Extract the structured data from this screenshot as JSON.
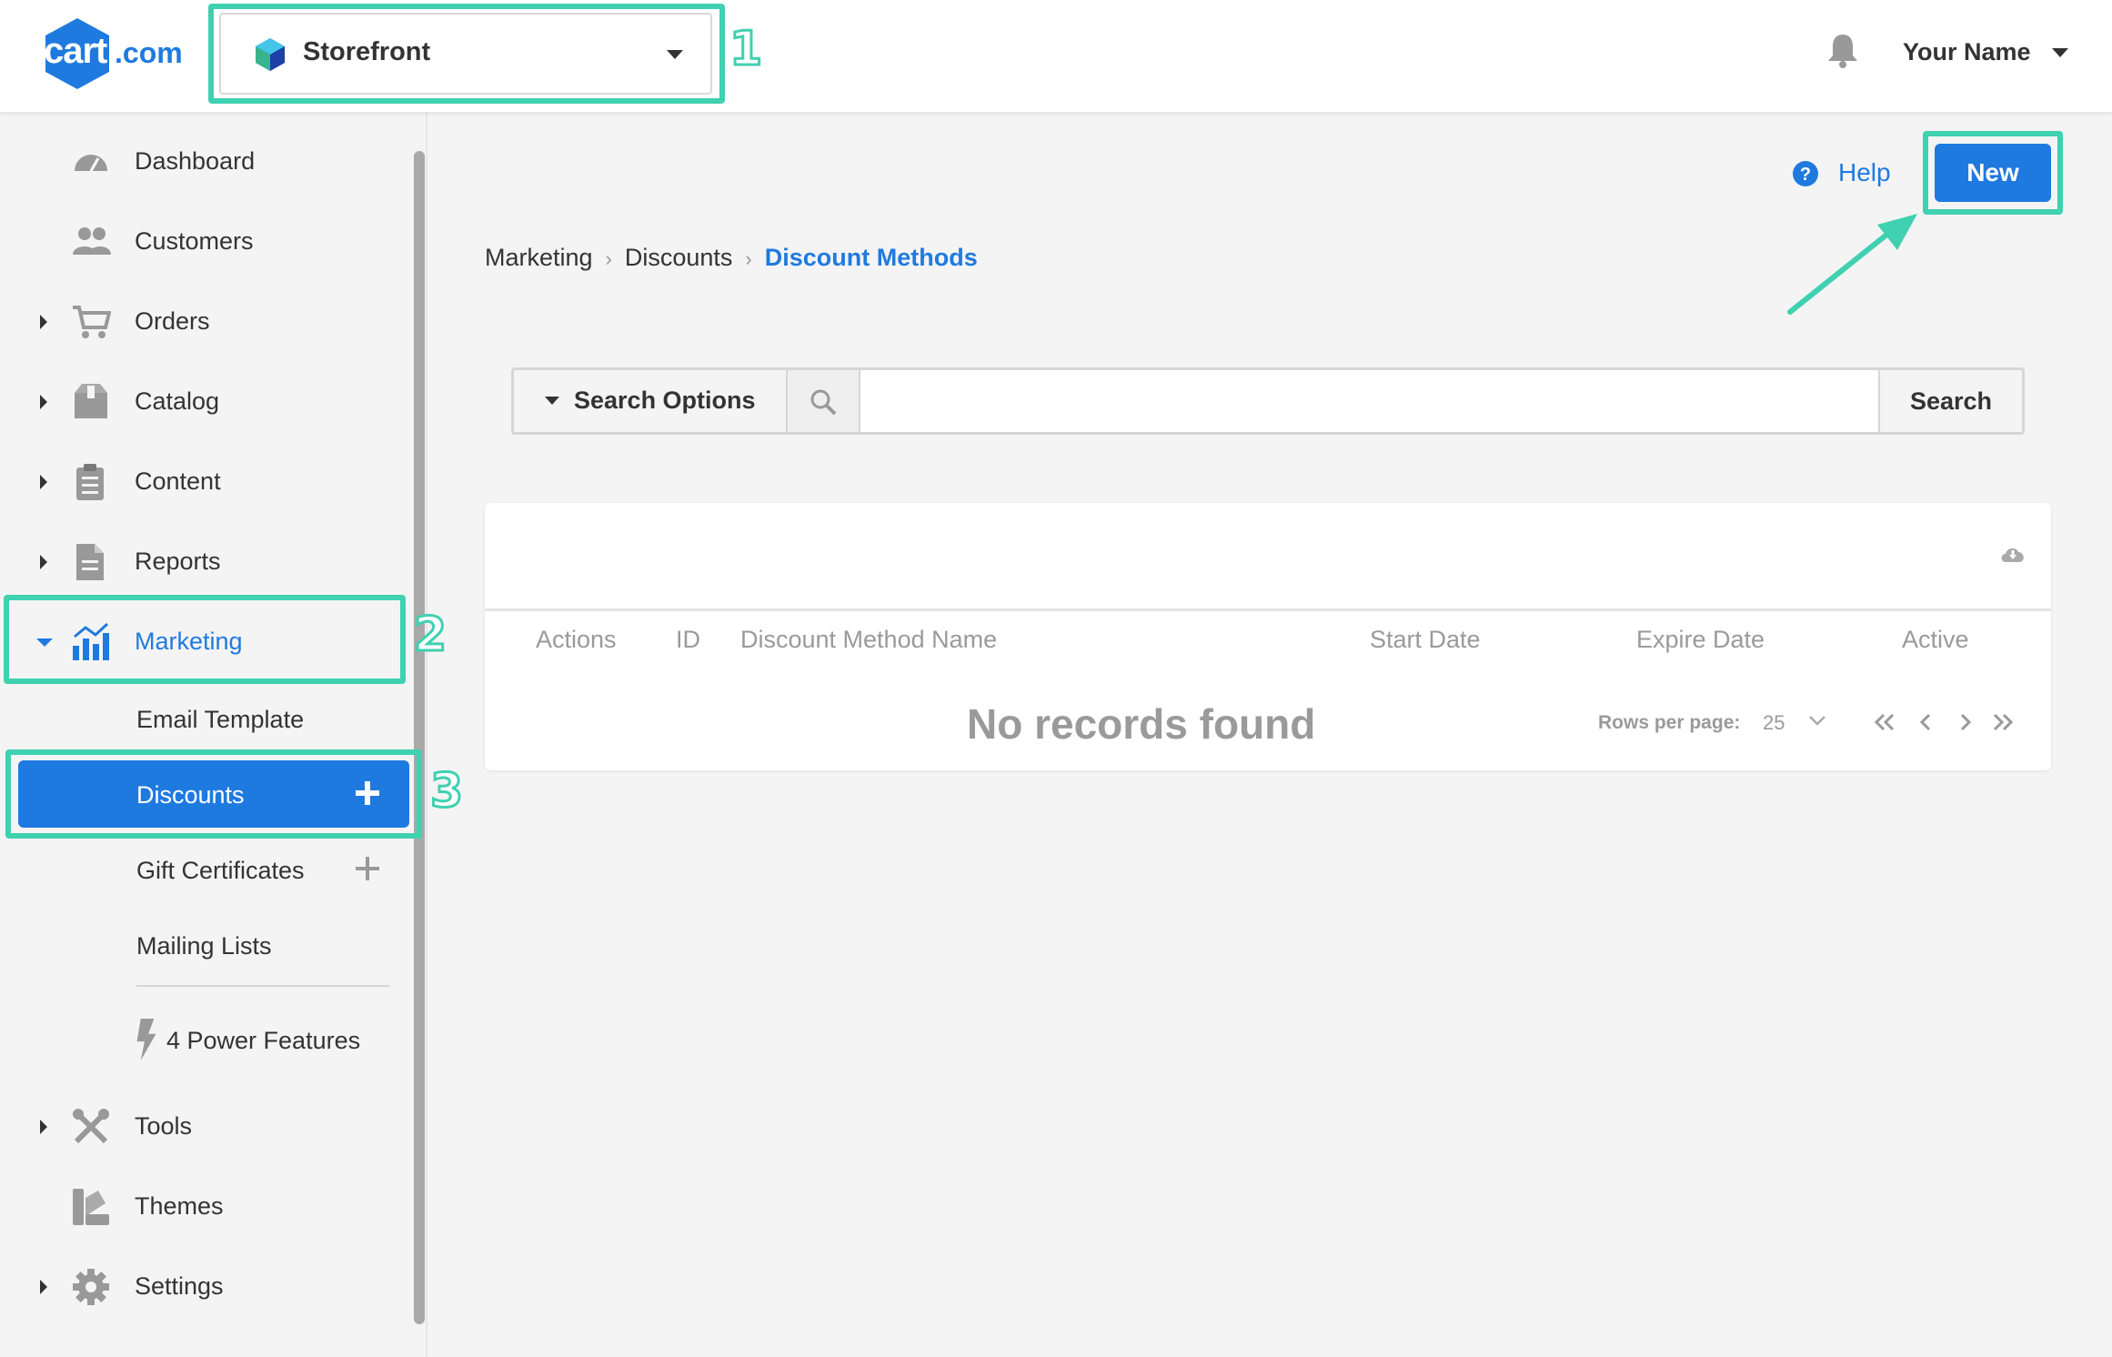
{
  "header": {
    "logo_text": "cart",
    "logo_suffix": ".com",
    "store_selector": "Storefront",
    "user_name": "Your Name"
  },
  "annotations": [
    "1",
    "2",
    "3"
  ],
  "sidebar": {
    "items": [
      {
        "label": "Dashboard",
        "icon": "dashboard-icon"
      },
      {
        "label": "Customers",
        "icon": "customers-icon"
      },
      {
        "label": "Orders",
        "icon": "cart-icon"
      },
      {
        "label": "Catalog",
        "icon": "box-icon"
      },
      {
        "label": "Content",
        "icon": "clipboard-icon"
      },
      {
        "label": "Reports",
        "icon": "document-icon"
      },
      {
        "label": "Marketing",
        "icon": "chart-icon"
      },
      {
        "label": "Tools",
        "icon": "tools-icon"
      },
      {
        "label": "Themes",
        "icon": "swatch-icon"
      },
      {
        "label": "Settings",
        "icon": "gear-icon"
      }
    ],
    "marketing_sub": [
      {
        "label": "Email Template"
      },
      {
        "label": "Discounts"
      },
      {
        "label": "Gift Certificates"
      },
      {
        "label": "Mailing Lists"
      }
    ],
    "power_features": "4 Power Features"
  },
  "main": {
    "help_label": "Help",
    "new_button": "New",
    "breadcrumb": [
      "Marketing",
      "Discounts",
      "Discount Methods"
    ],
    "search": {
      "options_label": "Search Options",
      "placeholder": "",
      "button_label": "Search"
    },
    "table": {
      "columns": [
        "Actions",
        "ID",
        "Discount Method Name",
        "Start Date",
        "Expire Date",
        "Active"
      ],
      "empty_message": "No records found",
      "rows_per_page_label": "Rows per page:",
      "rows_per_page_value": "25"
    }
  },
  "colors": {
    "accent": "#1f7ae0",
    "highlight": "#3fd1b0"
  }
}
